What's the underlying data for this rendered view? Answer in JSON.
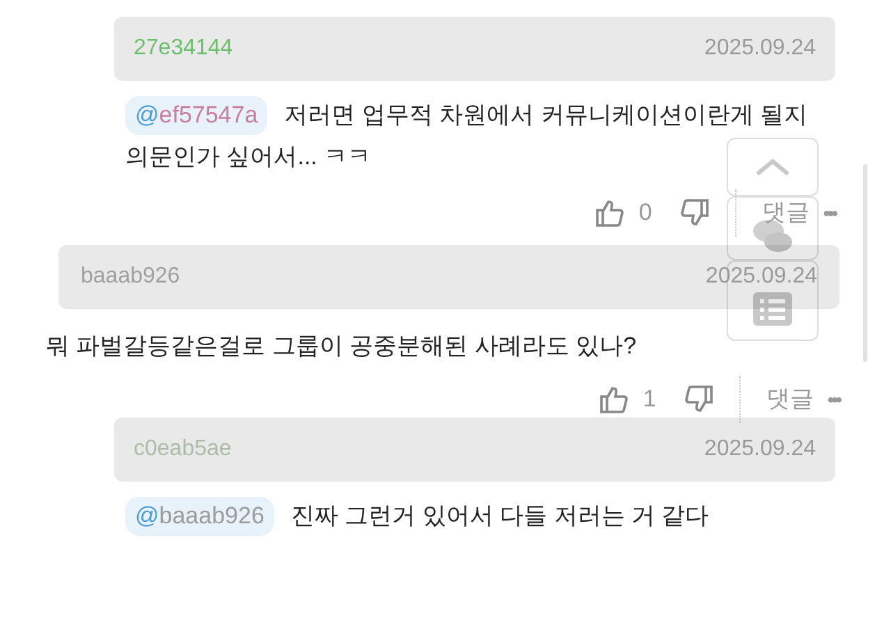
{
  "comments": [
    {
      "kind": "reply",
      "author": "27e34144",
      "color": "#6bbf6b",
      "date": "2025.09.24",
      "mention": "@ef57547a",
      "text": "저러면 업무적 차원에서 커뮤니케이션이란게 될지 의문인가 싶어서... ㅋㅋ",
      "likes": "0",
      "reply_label": "댓글",
      "more": "•••"
    },
    {
      "kind": "comment",
      "author": "baaab926",
      "color": "#a0a0a0",
      "date": "2025.09.24",
      "text": "뭐 파벌갈등같은걸로 그룹이 공중분해된 사례라도 있나?",
      "likes": "1",
      "reply_label": "댓글",
      "more": "•••"
    },
    {
      "kind": "reply",
      "author": "c0eab5ae",
      "color": "#aebba6",
      "date": "2025.09.24",
      "mention": "@baaab926",
      "text": "진짜 그런거 있어서 다들 저러는 거 같다"
    }
  ]
}
